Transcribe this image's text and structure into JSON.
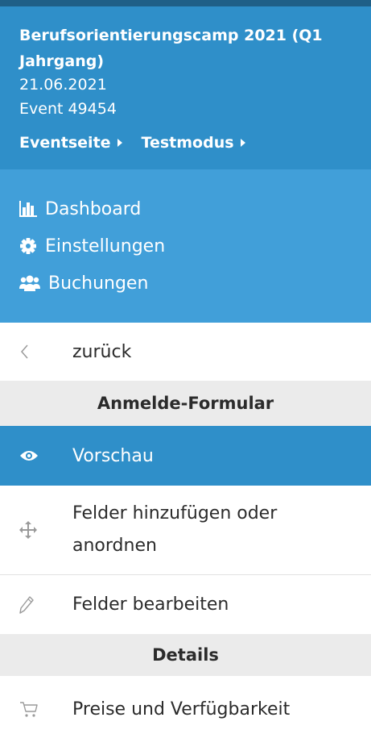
{
  "event": {
    "title_line1": "Berufsorientierungscamp 2021 (Q1",
    "title_line2": "Jahrgang)",
    "date": "21.06.2021",
    "event_id": "Event 49454",
    "link_event_page": "Eventseite",
    "link_test_mode": "Testmodus"
  },
  "nav": {
    "items": [
      {
        "label": "Dashboard",
        "icon": "bar-chart-icon"
      },
      {
        "label": "Einstellungen",
        "icon": "gear-icon"
      },
      {
        "label": "Buchungen",
        "icon": "users-icon"
      }
    ]
  },
  "menu": {
    "back_label": "zurück",
    "section_form": "Anmelde-Formular",
    "preview_label": "Vorschau",
    "add_fields_line1": "Felder hinzufügen oder",
    "add_fields_line2": "anordnen",
    "edit_fields_label": "Felder bearbeiten",
    "section_details": "Details",
    "prices_label": "Preise und Verfügbarkeit"
  },
  "colors": {
    "header_bg": "#2f8fc9",
    "nav_bg": "#419fd9",
    "active_bg": "#2f8fc9",
    "section_bg": "#ebebeb"
  }
}
